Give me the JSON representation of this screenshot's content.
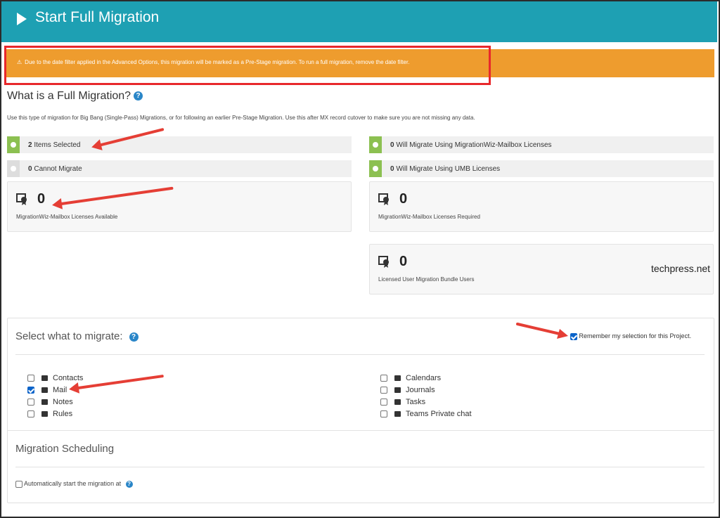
{
  "header": {
    "title": "Start Full Migration",
    "play_icon": "play-icon"
  },
  "warning": {
    "icon": "warning-icon",
    "text": "Due to the date filter applied in the Advanced Options, this migration will be marked as a Pre-Stage migration. To run a full migration, remove the date filter."
  },
  "section": {
    "title": "What is a Full Migration?",
    "intro": "Use this type of migration for Big Bang (Single-Pass) Migrations, or for following an earlier Pre-Stage Migration. Use this after MX record cutover to make sure you are not missing any data."
  },
  "stats": {
    "selected": {
      "value": "2",
      "label": "Items Selected"
    },
    "cannot": {
      "value": "0",
      "label": "Cannot Migrate"
    },
    "mailbox": {
      "value": "0",
      "label": "Will Migrate Using MigrationWiz-Mailbox Licenses"
    },
    "umb": {
      "value": "0",
      "label": "Will Migrate Using UMB Licenses"
    }
  },
  "cards": {
    "available": {
      "value": "0",
      "caption": "MigrationWiz-Mailbox Licenses Available"
    },
    "required": {
      "value": "0",
      "caption": "MigrationWiz-Mailbox Licenses Required"
    },
    "bundle": {
      "value": "0",
      "caption": "Licensed User Migration Bundle Users"
    }
  },
  "watermark": "techpress.net",
  "migrate": {
    "title": "Select what to migrate:",
    "remember_label": "Remember my selection for this Project.",
    "remember_checked": true,
    "options_left": [
      {
        "label": "Contacts",
        "checked": false,
        "icon": "contacts-icon"
      },
      {
        "label": "Mail",
        "checked": true,
        "icon": "mail-icon"
      },
      {
        "label": "Notes",
        "checked": false,
        "icon": "notes-icon"
      },
      {
        "label": "Rules",
        "checked": false,
        "icon": "rules-icon"
      }
    ],
    "options_right": [
      {
        "label": "Calendars",
        "checked": false,
        "icon": "calendar-icon"
      },
      {
        "label": "Journals",
        "checked": false,
        "icon": "journal-icon"
      },
      {
        "label": "Tasks",
        "checked": false,
        "icon": "tasks-icon"
      },
      {
        "label": "Teams Private chat",
        "checked": false,
        "icon": "chat-icon"
      }
    ]
  },
  "scheduling": {
    "title": "Migration Scheduling",
    "auto_label": "Automatically start the migration at",
    "auto_checked": false
  },
  "colors": {
    "header": "#1ea0b3",
    "warning": "#ee9c2e",
    "highlight": "#e8282b",
    "green": "#8cc051",
    "annotation_arrow": "#e53e35"
  }
}
